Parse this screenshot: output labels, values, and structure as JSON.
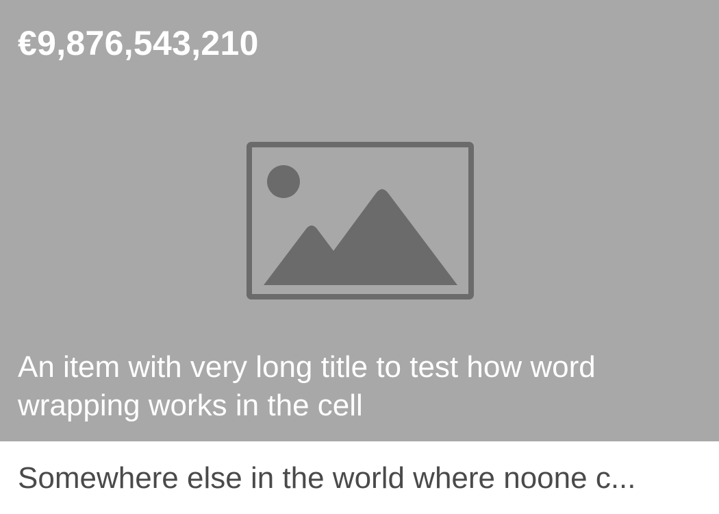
{
  "item": {
    "price": "€9,876,543,210",
    "title": "An item with very long title to test how word wrapping works in the cell",
    "location": "Somewhere else in the world where noone c..."
  },
  "icons": {
    "placeholder": "image-placeholder-icon"
  },
  "colors": {
    "media_background": "#a8a8a8",
    "icon_gray": "#6b6b6b",
    "overlay_text": "#ffffff",
    "subtitle_text": "#4a4a4a",
    "page_background": "#ffffff"
  }
}
